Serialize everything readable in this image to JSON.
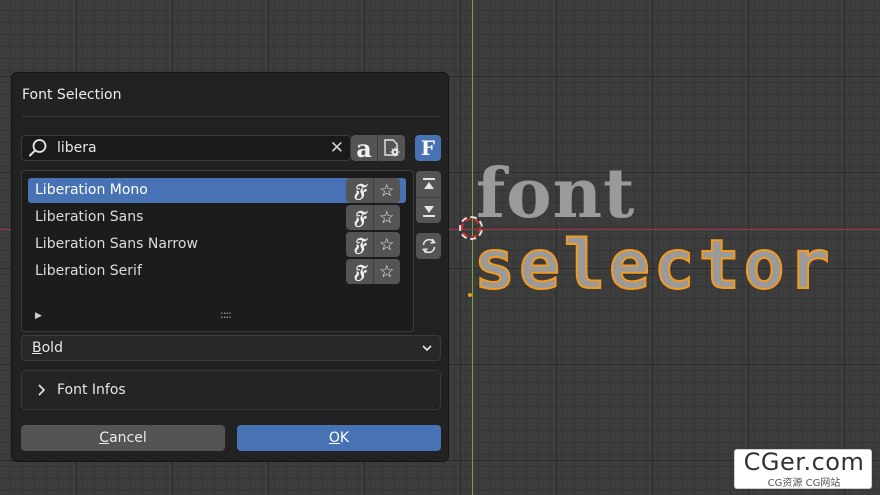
{
  "viewport": {
    "text_line1": "font",
    "text_line2": "selector"
  },
  "dialog": {
    "title": "Font Selection",
    "search": {
      "value": "libera",
      "placeholder": ""
    },
    "fonts": [
      {
        "label": "Liberation Mono",
        "selected": true
      },
      {
        "label": "Liberation Sans",
        "selected": false
      },
      {
        "label": "Liberation Sans Narrow",
        "selected": false
      },
      {
        "label": "Liberation Serif",
        "selected": false
      }
    ],
    "icons": {
      "preview_glyph": "a",
      "font_flag_glyph": "F",
      "row_font_glyph": "𝔉",
      "favorite_glyph": "☆",
      "expand_glyph": "▶",
      "grip_glyph": "::::",
      "clear_glyph": "✕"
    },
    "style_select": {
      "selected_first": "B",
      "selected_rest": "old"
    },
    "font_infos_label": "Font Infos",
    "buttons": {
      "cancel_first": "C",
      "cancel_rest": "ancel",
      "ok_first": "O",
      "ok_rest": "K"
    },
    "colors": {
      "accent": "#4772b3",
      "panel": "#222222",
      "outline_orange": "#f29a21"
    }
  },
  "watermark": {
    "main": "CGer.com",
    "sub": "CG资源 CG网站"
  }
}
